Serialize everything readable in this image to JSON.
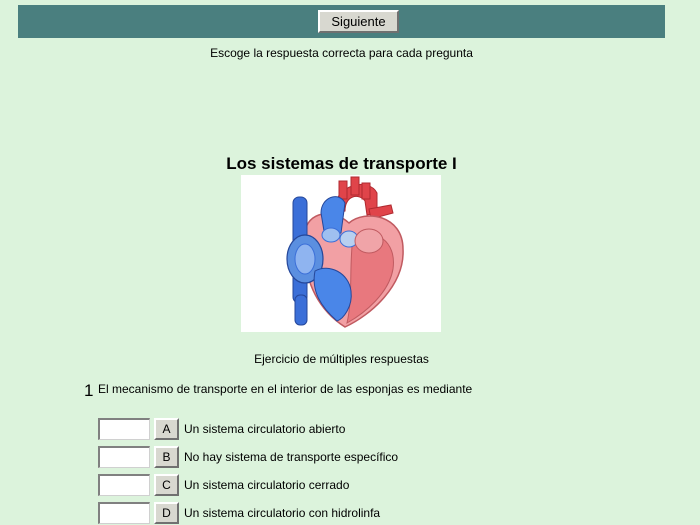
{
  "toolbar": {
    "next_label": "Siguiente"
  },
  "instruction": "Escoge la respuesta correcta para cada pregunta",
  "title": "Los sistemas de transporte I",
  "image": {
    "icon": "heart-anatomy-illustration"
  },
  "exercise_type": "Ejercicio de múltiples respuestas",
  "question": {
    "number": "1",
    "text": "El mecanismo de transporte en el interior de las esponjas es mediante",
    "options": [
      {
        "letter": "A",
        "text": "Un sistema circulatorio abierto",
        "value": ""
      },
      {
        "letter": "B",
        "text": "No hay sistema de transporte específico",
        "value": ""
      },
      {
        "letter": "C",
        "text": "Un sistema circulatorio cerrado",
        "value": ""
      },
      {
        "letter": "D",
        "text": "Un sistema circulatorio con hidrolinfa",
        "value": ""
      }
    ]
  },
  "colors": {
    "background": "#dcf3dc",
    "topbar": "#4a7f7f",
    "button": "#d8d8d0"
  }
}
